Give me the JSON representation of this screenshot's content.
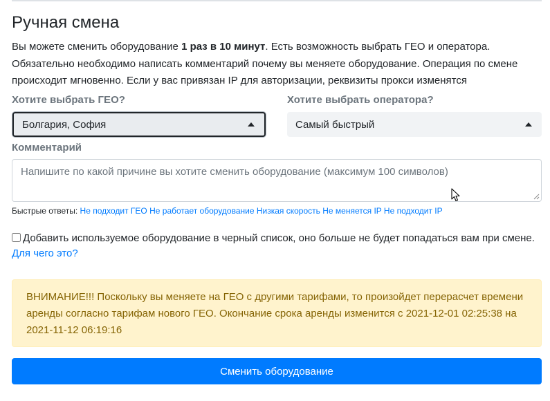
{
  "title": "Ручная смена",
  "description": {
    "before": "Вы можете сменить оборудование ",
    "bold": "1 раз в 10 минут",
    "after": ". Есть возможность выбрать ГЕО и оператора. Обязательно необходимо написать комментарий почему вы меняете оборудование. Операция по смене происходит мгновенно. Если у вас привязан IP для авторизации, реквизиты прокси изменятся"
  },
  "geo": {
    "label": "Хотите выбрать ГЕО?",
    "value": "Болгария, София"
  },
  "operator": {
    "label": "Хотите выбрать оператора?",
    "value": "Самый быстрый"
  },
  "comment": {
    "label": "Комментарий",
    "placeholder": "Напишите по какой причине вы хотите сменить оборудование (максимум 100 символов)"
  },
  "quick_answers": {
    "label": "Быстрые ответы:",
    "items": [
      "Не подходит ГЕО",
      "Не работает оборудование",
      "Низкая скорость",
      "Не меняется IP",
      "Не подходит IP"
    ]
  },
  "blacklist": {
    "label": "Добавить используемое оборудование в черный список, оно больше не будет попадаться вам при смене.",
    "link": "Для чего это?",
    "checked": false
  },
  "alert": {
    "text": "ВНИМАНИЕ!!! Поскольку вы меняете на ГЕО с другими тарифами, то произойдет перерасчет времени аренды согласно тарифам нового ГЕО. Окончание срока аренды изменится с 2021-12-01 02:25:38 на 2021-11-12 06:19:16"
  },
  "submit_label": "Сменить оборудование",
  "colors": {
    "primary": "#007bff",
    "alert_bg": "#fff3cd",
    "alert_text": "#856404",
    "label": "#6c757d"
  }
}
